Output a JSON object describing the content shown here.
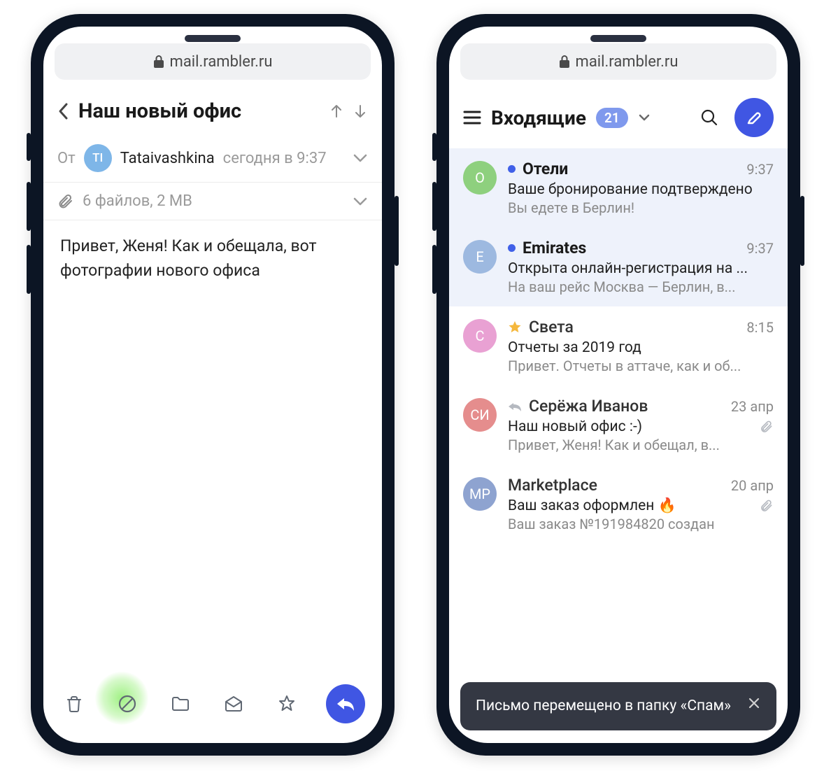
{
  "url": "mail.rambler.ru",
  "phone1": {
    "subject": "Наш новый офис",
    "from_label": "От",
    "sender": {
      "initials": "TI",
      "name": "Tataivashkina",
      "time": "сегодня в 9:37"
    },
    "attachments": "6 файлов, 2 MB",
    "body": "Привет, Женя! Как и обещала, вот фотографии нового офиса"
  },
  "phone2": {
    "folder": "Входящие",
    "unread_count": "21",
    "toast": "Письмо перемещено в папку «Спам»",
    "items": [
      {
        "avatar": "О",
        "avatar_class": "av-green",
        "unread": true,
        "selected": true,
        "sender": "Отели",
        "time": "9:37",
        "subject": "Ваше бронирование подтверждено",
        "preview": "Вы едете в Берлин!"
      },
      {
        "avatar": "E",
        "avatar_class": "av-lightblue",
        "unread": true,
        "selected": true,
        "sender": "Emirates",
        "time": "9:37",
        "subject": "Открыта онлайн-регистрация на ...",
        "preview": "На ваш рейс Москва — Берлин, в..."
      },
      {
        "avatar": "С",
        "avatar_class": "av-pink",
        "starred": true,
        "sender": "Света",
        "time": "8:15",
        "subject": "Отчеты за 2019 год",
        "preview": "Привет. Отчеты в аттаче, как и об..."
      },
      {
        "avatar": "СИ",
        "avatar_class": "av-salmon",
        "replied": true,
        "sender": "Серёжа Иванов",
        "time": "23 апр",
        "subject": "Наш новый офис :-)",
        "attach": true,
        "preview": "Привет, Женя! Как и обещал, в..."
      },
      {
        "avatar": "MP",
        "avatar_class": "av-bluegrey",
        "sender": "Marketplace",
        "time": "20 апр",
        "subject": "Ваш заказ оформлен 🔥",
        "attach": true,
        "preview": "Ваш заказ №191984820 создан"
      }
    ]
  }
}
